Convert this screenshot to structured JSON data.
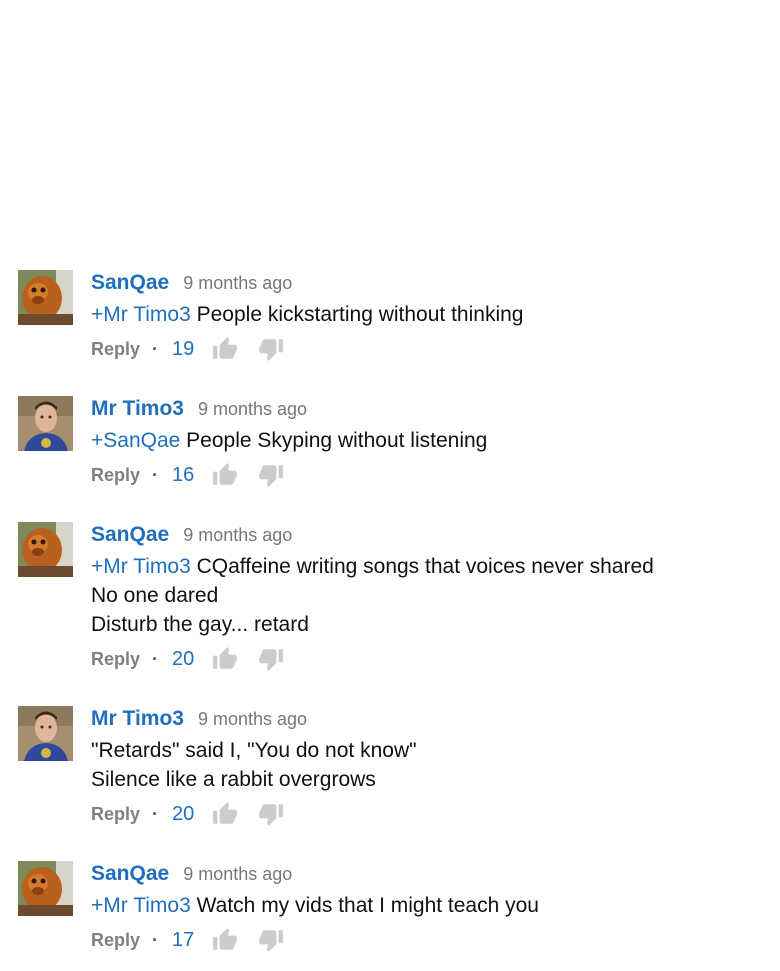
{
  "colors": {
    "author": "#1f6fbd",
    "mention": "#1f6fbd",
    "likes": "#1f6fbd",
    "timestamp": "#777777",
    "reply": "#808080",
    "thumb": "#cccccc"
  },
  "comments": [
    {
      "author": "SanQae",
      "time": "9 months ago",
      "mention": "+Mr Timo3",
      "lines": [
        "People kickstarting without thinking"
      ],
      "reply_label": "Reply",
      "separator": "·",
      "likes": "19",
      "like_icon": "thumbs-up-icon",
      "dislike_icon": "thumbs-down-icon"
    },
    {
      "author": "Mr Timo3",
      "time": "9 months ago",
      "mention": "+SanQae",
      "lines": [
        "People Skyping without listening"
      ],
      "reply_label": "Reply",
      "separator": "·",
      "likes": "16",
      "like_icon": "thumbs-up-icon",
      "dislike_icon": "thumbs-down-icon"
    },
    {
      "author": "SanQae",
      "time": "9 months ago",
      "mention": "+Mr Timo3",
      "lines": [
        "CQaffeine writing songs that voices never shared",
        "No one dared",
        "Disturb the gay... retard"
      ],
      "reply_label": "Reply",
      "separator": "·",
      "likes": "20",
      "like_icon": "thumbs-up-icon",
      "dislike_icon": "thumbs-down-icon"
    },
    {
      "author": "Mr Timo3",
      "time": "9 months ago",
      "mention": "",
      "lines": [
        "\"Retards\" said I, \"You do not know\"",
        "Silence like a rabbit overgrows"
      ],
      "reply_label": "Reply",
      "separator": "·",
      "likes": "20",
      "like_icon": "thumbs-up-icon",
      "dislike_icon": "thumbs-down-icon"
    },
    {
      "author": "SanQae",
      "time": "9 months ago",
      "mention": "+Mr Timo3",
      "lines": [
        "Watch my vids that I might teach you"
      ],
      "reply_label": "Reply",
      "separator": "·",
      "likes": "17",
      "like_icon": "thumbs-up-icon",
      "dislike_icon": "thumbs-down-icon"
    }
  ]
}
